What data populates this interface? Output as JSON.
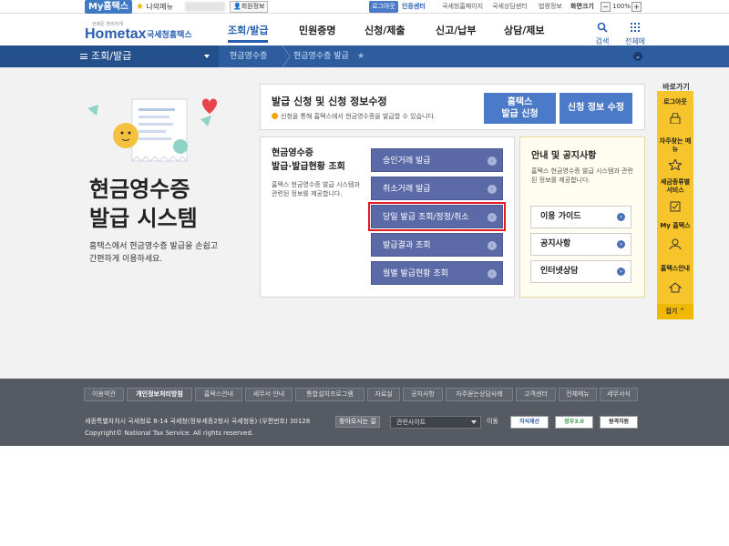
{
  "topbar": {
    "my_hometax": "My홈택스",
    "my_menu": "나의메뉴",
    "member_info": "회원정보",
    "login": "로그아웃",
    "cert_center": "인증센터",
    "links": [
      "국세청홈페이지",
      "국세상담센터",
      "법령정보"
    ],
    "zoom_label": "화면크기",
    "zoom_minus": "−",
    "zoom_value": "100%",
    "zoom_plus": "+"
  },
  "header": {
    "logo_text": "Hometax",
    "logo_sub": "국세청홈택스",
    "logo_tagline": "언제든 편리하게",
    "nav": [
      "조회/발급",
      "민원증명",
      "신청/제출",
      "신고/납부",
      "상담/제보"
    ],
    "active_nav": 0,
    "search": "검색",
    "all_menu": "전체메뉴"
  },
  "locbar": {
    "menu_label": "조회/발급",
    "crumbs": [
      "현금영수증",
      "현금영수증 발급"
    ]
  },
  "hero": {
    "title_line1": "현금영수증",
    "title_line2": "발급 시스템",
    "desc_line1": "홈택스에서 현금영수증 발급을 손쉽고",
    "desc_line2": "간편하게 이용하세요."
  },
  "apply_panel": {
    "title": "발급 신청 및 신청 정보수정",
    "note": "신청을 통해 홈택스에서 현금영수증을 발급할 수 있습니다.",
    "btn_apply_line1": "홈택스",
    "btn_apply_line2": "발급 신청",
    "btn_edit": "신청 정보 수정"
  },
  "issue_panel": {
    "title_line1": "현금영수증",
    "title_line2": "발급·발급현황 조회",
    "desc": "홈택스 현금영수증 발급 시스템과 관련된 정보를 제공합니다.",
    "buttons": [
      "승인거래 발급",
      "취소거래 발급",
      "당일 발급 조회/정정/취소",
      "발급결과 조회",
      "월별 발급현황 조회"
    ]
  },
  "info_panel": {
    "title": "안내 및 공지사항",
    "desc": "홈택스 현금영수증 발급 시스템과 관련된 정보를 제공합니다.",
    "buttons": [
      "이용 가이드",
      "공지사항",
      "인터넷상담"
    ]
  },
  "quickbar": {
    "title": "바로가기",
    "items": [
      "로그아웃",
      "자주찾는 메뉴",
      "세금종류별 서비스",
      "My 홈택스",
      "홈택스안내"
    ],
    "fold": "접기"
  },
  "footer": {
    "links": [
      "이용약관",
      "개인정보처리방침",
      "홈택스안내",
      "세무서 안내",
      "통합설치프로그램",
      "자료실",
      "공지사항",
      "자주묻는상담사례",
      "고객센터",
      "전체메뉴",
      "세무서식"
    ],
    "address": "세종특별자치시 국세청로 8-14 국세청(정부세종2청사 국세청동) (우편번호) 30128",
    "way_btn": "찾아오시는 길",
    "related_sites": "관련사이트",
    "go": "이동",
    "copyright": "Copyright© National Tax Service. All rights reserved.",
    "badges": [
      "지식재산",
      "정부3.0",
      "원격지원"
    ]
  }
}
